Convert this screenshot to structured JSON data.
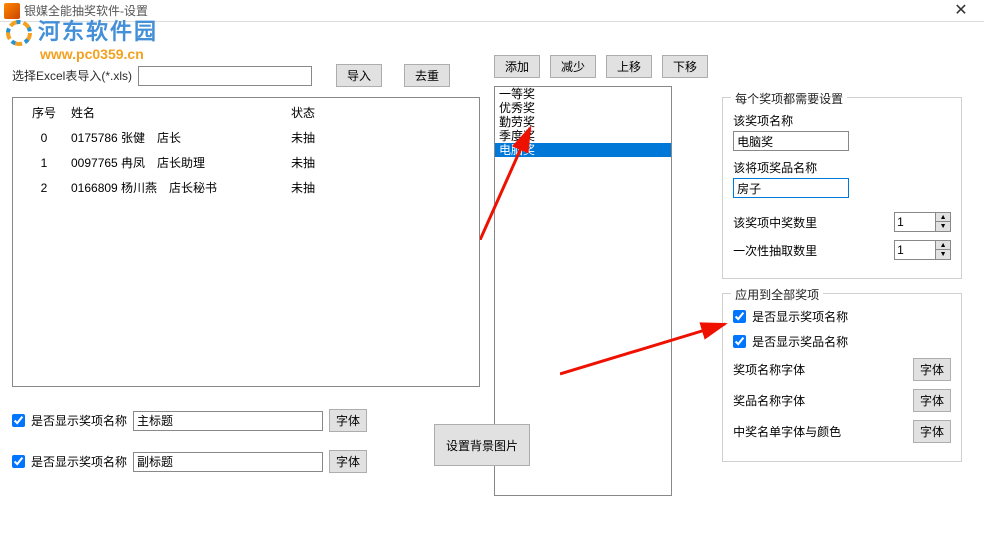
{
  "window": {
    "title": "银媒全能抽奖软件-设置",
    "close": "✕"
  },
  "watermark": {
    "brand": "河东软件园",
    "url": "www.pc0359.cn"
  },
  "importRow": {
    "label": "选择Excel表导入(*.xls)",
    "path": "",
    "importBtn": "导入",
    "dedupBtn": "去重"
  },
  "midButtons": {
    "add": "添加",
    "remove": "减少",
    "up": "上移",
    "down": "下移"
  },
  "table": {
    "headers": {
      "no": "序号",
      "name": "姓名",
      "status": "状态"
    },
    "rows": [
      {
        "no": "0",
        "id": "0175786",
        "name": "张健　店长",
        "status": "未抽"
      },
      {
        "no": "1",
        "id": "0097765",
        "name": "冉凤　店长助理",
        "status": "未抽"
      },
      {
        "no": "2",
        "id": "0166809",
        "name": "杨川燕　店长秘书",
        "status": "未抽"
      }
    ]
  },
  "titleChecks": {
    "label1": "是否显示奖项名称",
    "value1": "主标题",
    "font": "字体",
    "label2": "是否显示奖项名称",
    "value2": "副标题"
  },
  "bgBtn": "设置背景图片",
  "prizeList": {
    "items": [
      "一等奖",
      "优秀奖",
      "勤劳奖",
      "季度奖",
      "电脑奖"
    ],
    "selectedIndex": 4
  },
  "prizeSettings": {
    "legend": "每个奖项都需要设置",
    "nameLabel": "该奖项名称",
    "nameValue": "电脑奖",
    "itemLabel": "该将项奖品名称",
    "itemValue": "房子",
    "countLabel": "该奖项中奖数里",
    "countValue": "1",
    "perLabel": "一次性抽取数里",
    "perValue": "1"
  },
  "applyAll": {
    "legend": "应用到全部奖项",
    "chk1": "是否显示奖项名称",
    "chk2": "是否显示奖品名称",
    "fontRow1": "奖项名称字体",
    "fontRow2": "奖品名称字体",
    "fontRow3": "中奖名单字体与颜色",
    "fontBtn": "字体"
  }
}
